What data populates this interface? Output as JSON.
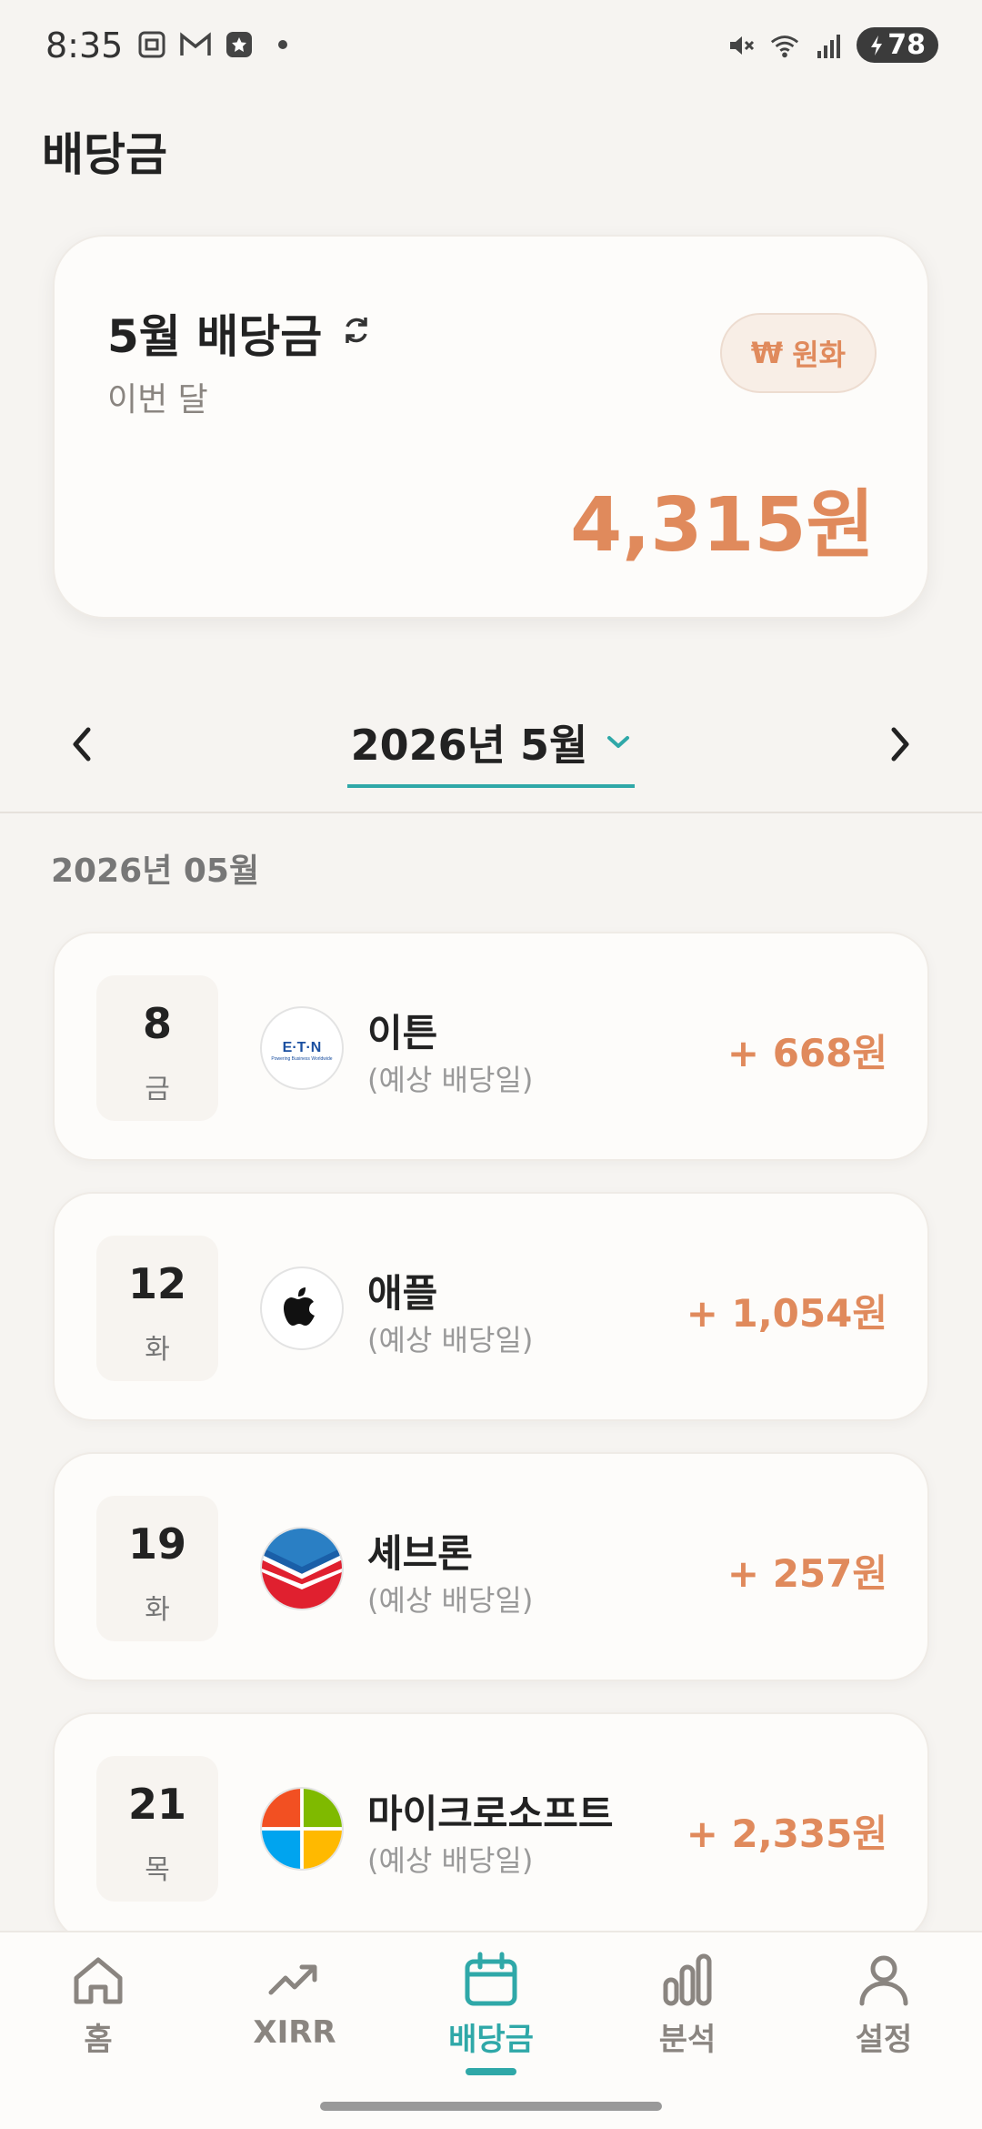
{
  "status_bar": {
    "time": "8:35",
    "battery": "78",
    "left_icons": [
      "screenshot-icon",
      "gmail-icon",
      "app-badge-icon",
      "dot-icon"
    ],
    "right_icons": [
      "mute-icon",
      "wifi-icon",
      "signal-icon"
    ]
  },
  "page": {
    "title": "배당금"
  },
  "summary": {
    "title": "5월 배당금",
    "subtitle": "이번 달",
    "currency_label": "원화",
    "currency_symbol": "₩",
    "amount": "4,315원"
  },
  "month_nav": {
    "selected": "2026년 5월"
  },
  "section": {
    "label": "2026년 05월"
  },
  "dividends": [
    {
      "day": "8",
      "weekday": "금",
      "company": "이튼",
      "note": "(예상 배당일)",
      "amount": "+ 668원",
      "logo": "eaton-logo"
    },
    {
      "day": "12",
      "weekday": "화",
      "company": "애플",
      "note": "(예상 배당일)",
      "amount": "+ 1,054원",
      "logo": "apple-logo"
    },
    {
      "day": "19",
      "weekday": "화",
      "company": "셰브론",
      "note": "(예상 배당일)",
      "amount": "+ 257원",
      "logo": "chevron-logo"
    },
    {
      "day": "21",
      "weekday": "목",
      "company": "마이크로소프트",
      "note": "(예상 배당일)",
      "amount": "+ 2,335원",
      "logo": "microsoft-logo"
    }
  ],
  "bottom_nav": {
    "items": [
      {
        "label": "홈",
        "icon": "home-icon"
      },
      {
        "label": "XIRR",
        "icon": "trend-icon"
      },
      {
        "label": "배당금",
        "icon": "calendar-icon"
      },
      {
        "label": "분석",
        "icon": "bar-chart-icon"
      },
      {
        "label": "설정",
        "icon": "person-icon"
      }
    ],
    "active": "배당금"
  },
  "colors": {
    "accent": "#2fa8a8",
    "amount": "#e08a5c",
    "background": "#f6f4f1"
  }
}
